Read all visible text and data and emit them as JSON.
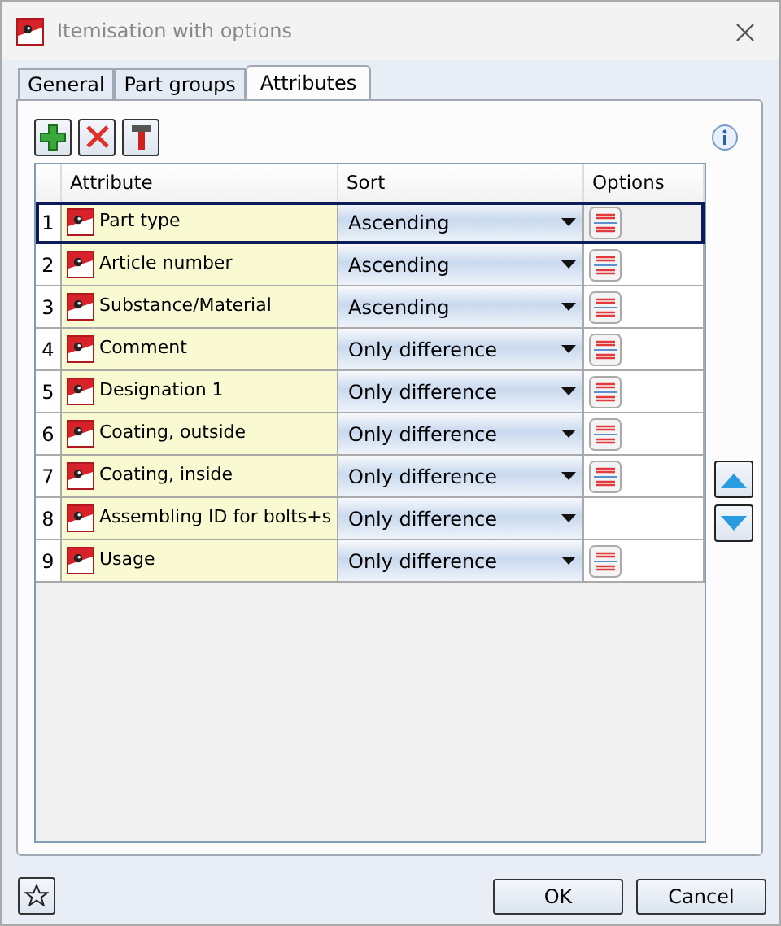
{
  "window": {
    "title": "Itemisation with options"
  },
  "tabs": [
    {
      "label": "General",
      "selected": false
    },
    {
      "label": "Part groups",
      "selected": false
    },
    {
      "label": "Attributes",
      "selected": true
    }
  ],
  "table": {
    "columns": [
      "Attribute",
      "Sort",
      "Options"
    ],
    "rows": [
      {
        "number": "1",
        "attribute": "Part type",
        "sort": "Ascending",
        "options": true,
        "selected": true
      },
      {
        "number": "2",
        "attribute": "Article number",
        "sort": "Ascending",
        "options": true,
        "selected": false
      },
      {
        "number": "3",
        "attribute": "Substance/Material",
        "sort": "Ascending",
        "options": true,
        "selected": false
      },
      {
        "number": "4",
        "attribute": "Comment",
        "sort": "Only difference",
        "options": true,
        "selected": false
      },
      {
        "number": "5",
        "attribute": "Designation 1",
        "sort": "Only difference",
        "options": true,
        "selected": false
      },
      {
        "number": "6",
        "attribute": "Coating, outside",
        "sort": "Only difference",
        "options": true,
        "selected": false
      },
      {
        "number": "7",
        "attribute": "Coating, inside",
        "sort": "Only difference",
        "options": true,
        "selected": false
      },
      {
        "number": "8",
        "attribute": "Assembling ID for bolts+s",
        "sort": "Only difference",
        "options": false,
        "selected": false
      },
      {
        "number": "9",
        "attribute": "Usage",
        "sort": "Only difference",
        "options": true,
        "selected": false
      }
    ]
  },
  "buttons": [
    "OK",
    "Cancel"
  ]
}
